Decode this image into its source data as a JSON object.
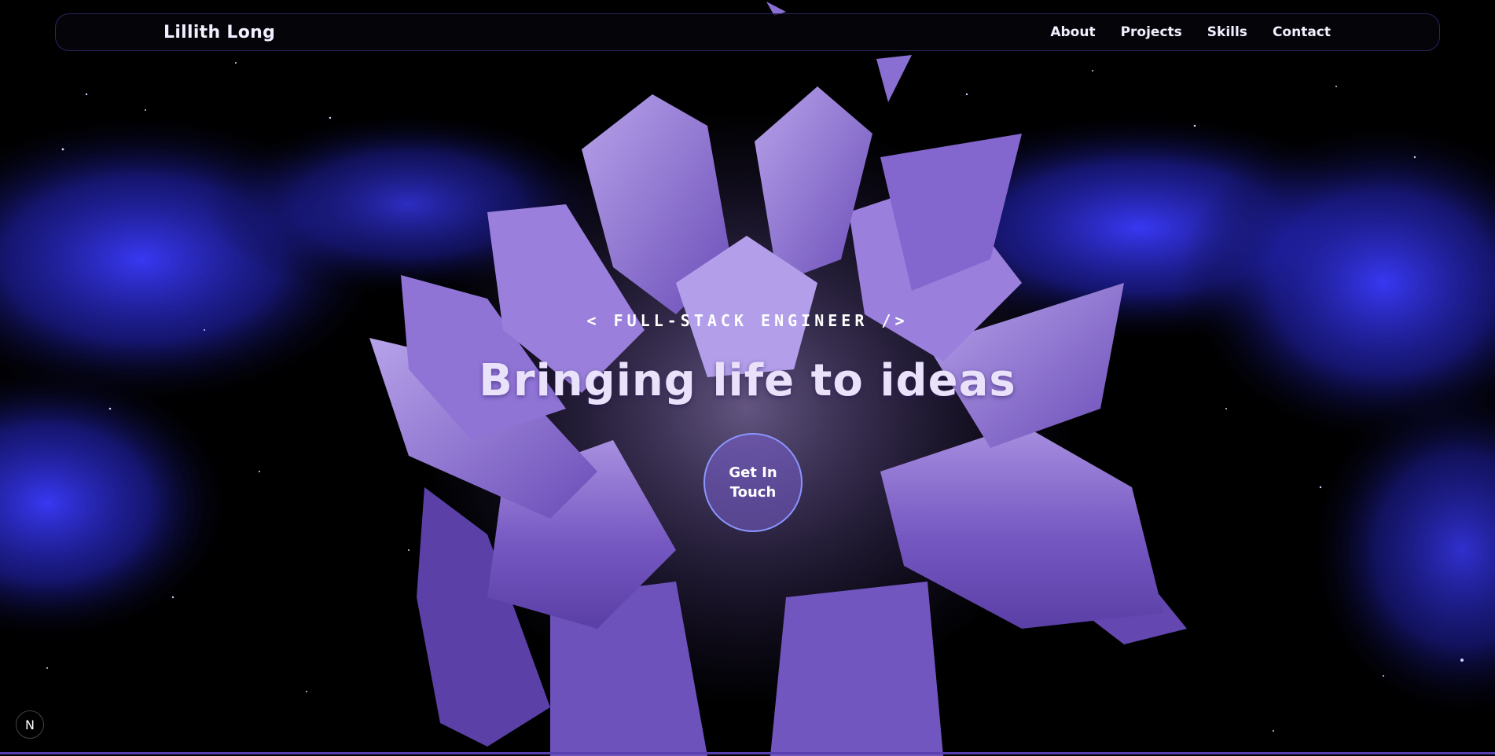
{
  "nav": {
    "brand": "Lillith Long",
    "links": [
      "About",
      "Projects",
      "Skills",
      "Contact"
    ]
  },
  "hero": {
    "tagline": "< FULL-STACK ENGINEER />",
    "headline": "Bringing life to ideas",
    "cta_label": "Get In Touch"
  },
  "badge": {
    "label": "N"
  },
  "colors": {
    "background": "#000000",
    "nebula": "#2f2fd8",
    "flower": "#7a5cc4",
    "accent_border": "#8b95ff"
  }
}
